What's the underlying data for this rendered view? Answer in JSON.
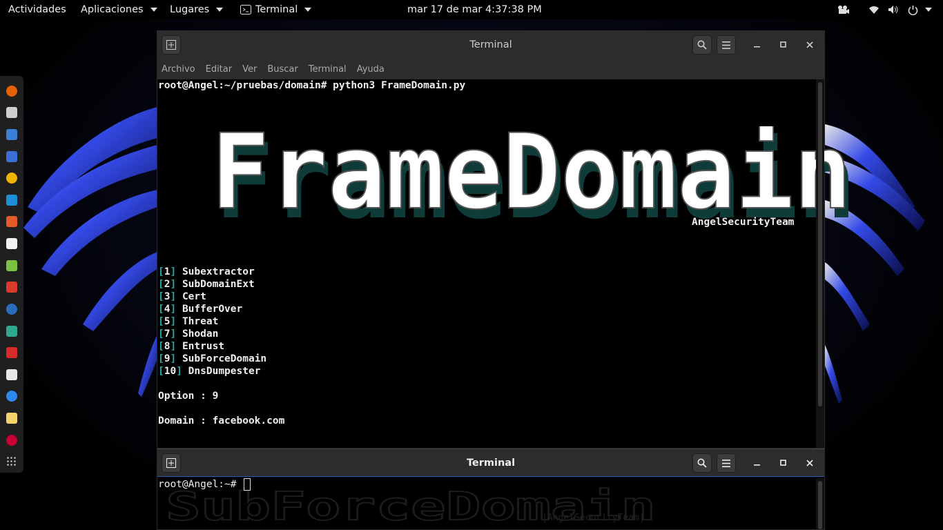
{
  "topbar": {
    "activities": "Actividades",
    "applications": "Aplicaciones",
    "places": "Lugares",
    "terminal_app": "Terminal",
    "clock": "mar 17 de mar  4:37:38 PM"
  },
  "dock": {
    "icons": [
      "firefox-icon",
      "terminal-icon",
      "files-icon",
      "metasploit-icon",
      "burpsuite-icon",
      "maltego-icon",
      "armitage-icon",
      "zaproxy-icon",
      "leafpad-icon",
      "office-icon",
      "wireshark-icon",
      "android-icon",
      "fern-icon",
      "text-editor-icon",
      "chat-icon",
      "notes-icon",
      "debian-icon",
      "app-grid-icon"
    ],
    "colors": [
      "#e66000",
      "#cfcfcf",
      "#3b7fd6",
      "#3c6fd6",
      "#f0b400",
      "#1e8ed6",
      "#e35b2a",
      "#f2f2f2",
      "#7bc142",
      "#d83b2b",
      "#2a6ebb",
      "#2fa88e",
      "#d62b2b",
      "#e6e6e6",
      "#2d89ef",
      "#f5d36b",
      "#c70036",
      "#cccccc"
    ]
  },
  "window1": {
    "title": "Terminal",
    "menu": [
      "Archivo",
      "Editar",
      "Ver",
      "Buscar",
      "Terminal",
      "Ayuda"
    ],
    "prompt": "root@Angel:~/pruebas/domain# python3 FrameDomain.py",
    "banner": "FrameDomain",
    "team": "AngelSecurityTeam",
    "options": [
      {
        "num": "1",
        "name": "Subextractor"
      },
      {
        "num": "2",
        "name": "SubDomainExt"
      },
      {
        "num": "3",
        "name": "Cert"
      },
      {
        "num": "4",
        "name": "BufferOver"
      },
      {
        "num": "5",
        "name": "Threat"
      },
      {
        "num": "7",
        "name": "Shodan"
      },
      {
        "num": "8",
        "name": "Entrust"
      },
      {
        "num": "9",
        "name": "SubForceDomain"
      },
      {
        "num": "10",
        "name": "DnsDumpester"
      }
    ],
    "option_line": "Option : 9",
    "domain_line": "Domain : facebook.com"
  },
  "window2": {
    "title": "Terminal",
    "prompt": "root@Angel:~# ",
    "watermark": "SubForceDomain",
    "watermark_team": "|AngelSecurityTeam|"
  },
  "colors": {
    "accent": "#2aa3a3",
    "titlebar": "#2c2c2c",
    "wing": "#2b3fd8"
  }
}
